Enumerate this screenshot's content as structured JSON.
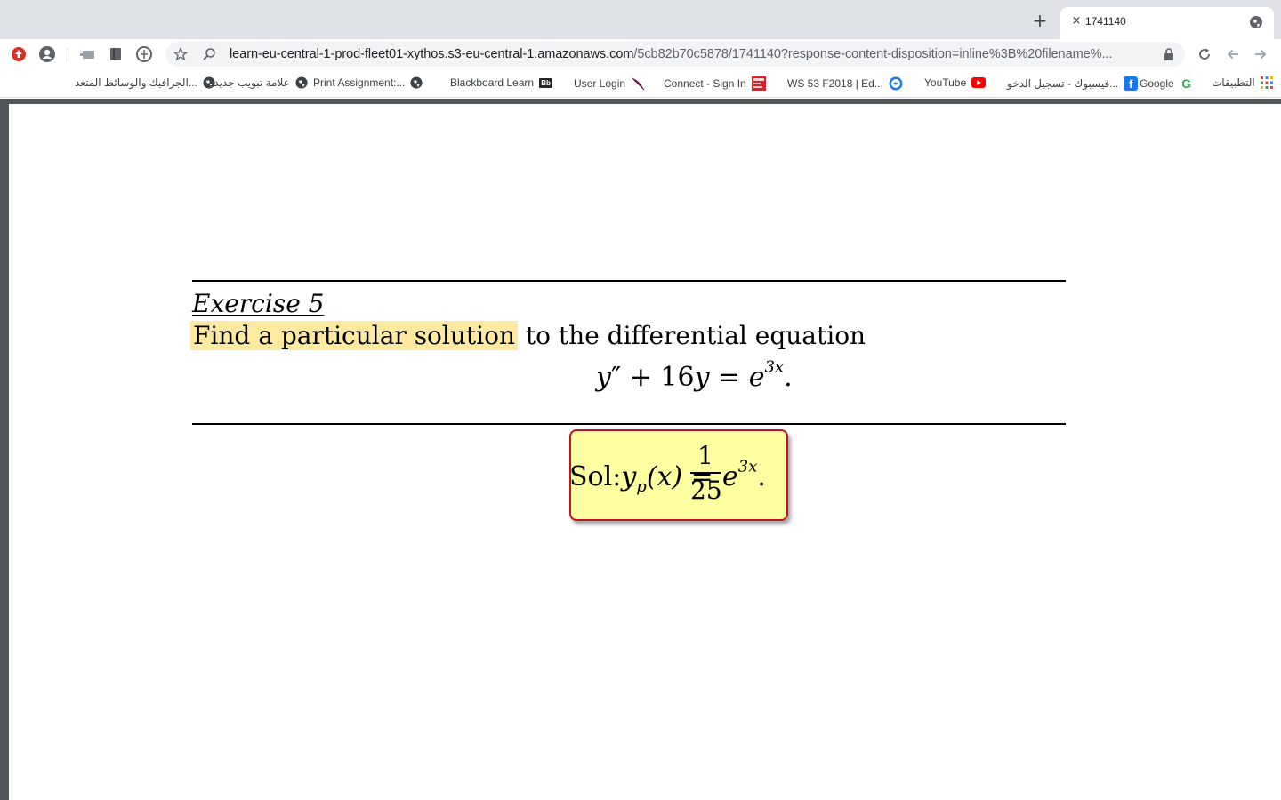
{
  "browser": {
    "tab": {
      "title": "1741140",
      "close_glyph": "×"
    },
    "new_tab_glyph": "+",
    "url": {
      "host": "learn-eu-central-1-prod-fleet01-xythos.s3-eu-central-1.amazonaws.com",
      "path": "/5cb82b70c5878/1741140?response-content-disposition=inline%3B%20filename%..."
    },
    "icons": [
      "update-icon",
      "profile-icon",
      "extension-icon",
      "reading-list-icon",
      "translate-icon",
      "star-icon",
      "zoom-icon",
      "lock-icon",
      "reload-icon",
      "back-icon",
      "forward-icon",
      "globe-icon"
    ]
  },
  "bookmarks": [
    {
      "label": "الجرافيك والوسائط المتعد...",
      "icon": "globe-icon"
    },
    {
      "label": "علامة تبويب جديدة",
      "icon": "globe-icon"
    },
    {
      "label": "Print Assignment:...",
      "icon": "globe-icon"
    },
    {
      "label": "Blackboard Learn",
      "icon": "blackboard-icon",
      "icon_text": "Bb"
    },
    {
      "label": "User Login",
      "icon": "feather-icon"
    },
    {
      "label": "Connect - Sign In",
      "icon": "connect-icon"
    },
    {
      "label": "WS 53 F2018 | Ed...",
      "icon": "edpuzzle-icon"
    },
    {
      "label": "YouTube",
      "icon": "youtube-icon"
    },
    {
      "label": "فيسبوك - تسجيل الدخو...",
      "icon": "facebook-icon",
      "icon_text": "f"
    },
    {
      "label": "Google",
      "icon": "google-icon",
      "icon_text": "G"
    },
    {
      "label": "التطبيقات",
      "icon": "apps-icon"
    }
  ],
  "document": {
    "exercise_title": "Exercise 5",
    "prompt_highlighted": "Find a particular solution",
    "prompt_rest": " to the differential equation",
    "equation": {
      "lhs_y": "y",
      "prime": "″",
      "middle": " + 16",
      "y2": "y",
      "eq": " = ",
      "base": "e",
      "exp": "3x",
      "end": "."
    },
    "solution": {
      "prefix": "Sol:",
      "y": "y",
      "sub": "p",
      "arg": "(x)",
      "equals": " =",
      "numerator": "1",
      "denominator": "25",
      "base": "e",
      "exp": "3x",
      "end": "."
    }
  },
  "colors": {
    "highlight": "#fdeaa0",
    "solution_fill": "#ffffa2",
    "solution_border": "#c1121f",
    "viewer_bg": "#525659"
  }
}
